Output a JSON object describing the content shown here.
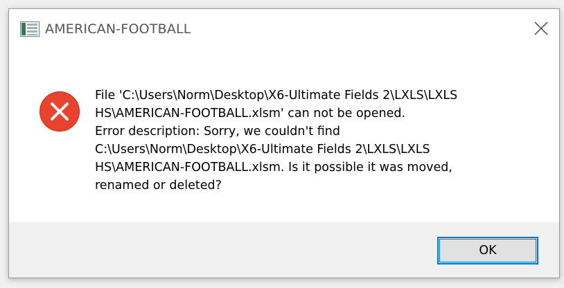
{
  "window": {
    "title": "AMERICAN-FOOTBALL",
    "app_icon": "spreadsheet-icon",
    "close_icon": "close-icon"
  },
  "message": {
    "icon": "error-icon",
    "icon_color": "#e8432f",
    "lines": [
      "File 'C:\\Users\\Norm\\Desktop\\X6-Ultimate Fields 2\\LXLS\\LXLS",
      "HS\\AMERICAN-FOOTBALL.xlsm' can not be opened.",
      "Error description: Sorry, we couldn't find",
      "C:\\Users\\Norm\\Desktop\\X6-Ultimate Fields 2\\LXLS\\LXLS",
      "HS\\AMERICAN-FOOTBALL.xlsm. Is it possible it was moved,",
      "renamed or deleted?"
    ]
  },
  "buttons": {
    "ok_label": "OK"
  },
  "colors": {
    "accent": "#0078d7",
    "footer_bg": "#f0f0f0"
  }
}
